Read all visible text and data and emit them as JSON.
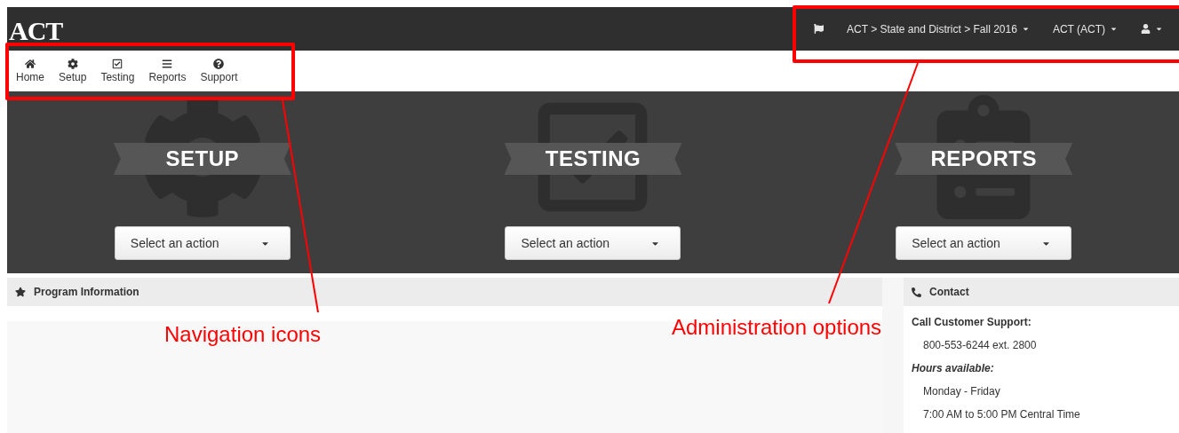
{
  "header": {
    "logo": "ACT",
    "admin_menus": [
      {
        "label": "ACT > State and District > Fall 2016"
      },
      {
        "label": "ACT (ACT)"
      }
    ]
  },
  "nav": [
    {
      "label": "Home"
    },
    {
      "label": "Setup"
    },
    {
      "label": "Testing"
    },
    {
      "label": "Reports"
    },
    {
      "label": "Support"
    }
  ],
  "sections": [
    {
      "title": "SETUP",
      "action": "Select an action"
    },
    {
      "title": "TESTING",
      "action": "Select an action"
    },
    {
      "title": "REPORTS",
      "action": "Select an action"
    }
  ],
  "program_panel": {
    "title": "Program Information"
  },
  "contact_panel": {
    "title": "Contact",
    "lines": [
      {
        "kind": "heading",
        "text": "Call Customer Support:"
      },
      {
        "kind": "detail",
        "text": "800-553-6244 ext. 2800"
      },
      {
        "kind": "subheading",
        "text": "Hours available:"
      },
      {
        "kind": "detail",
        "text": "Monday - Friday"
      },
      {
        "kind": "detail",
        "text": "7:00 AM to 5:00 PM Central Time"
      }
    ]
  },
  "annotations": [
    {
      "text": "Navigation icons"
    },
    {
      "text": "Administration options"
    }
  ]
}
